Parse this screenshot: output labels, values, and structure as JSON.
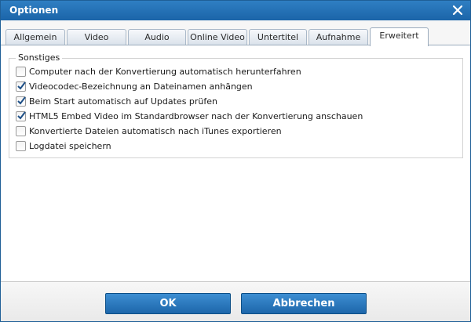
{
  "window": {
    "title": "Optionen",
    "close_icon": "close-icon"
  },
  "tabs": [
    {
      "label": "Allgemein",
      "active": false
    },
    {
      "label": "Video",
      "active": false
    },
    {
      "label": "Audio",
      "active": false
    },
    {
      "label": "Online Video",
      "active": false
    },
    {
      "label": "Untertitel",
      "active": false
    },
    {
      "label": "Aufnahme",
      "active": false
    },
    {
      "label": "Erweitert",
      "active": true
    }
  ],
  "group": {
    "title": "Sonstiges",
    "options": [
      {
        "label": "Computer nach der Konvertierung automatisch herunterfahren",
        "checked": false
      },
      {
        "label": "Videocodec-Bezeichnung an Dateinamen anhängen",
        "checked": true
      },
      {
        "label": "Beim Start automatisch auf Updates prüfen",
        "checked": true
      },
      {
        "label": "HTML5 Embed Video im Standardbrowser nach der Konvertierung anschauen",
        "checked": true
      },
      {
        "label": "Konvertierte Dateien automatisch nach iTunes exportieren",
        "checked": false
      },
      {
        "label": "Logdatei speichern",
        "checked": false
      }
    ]
  },
  "buttons": {
    "ok": "OK",
    "cancel": "Abbrechen"
  },
  "colors": {
    "titlebar": "#1f6cb3",
    "button": "#2a78bf",
    "checkmark": "#1d4f87"
  }
}
